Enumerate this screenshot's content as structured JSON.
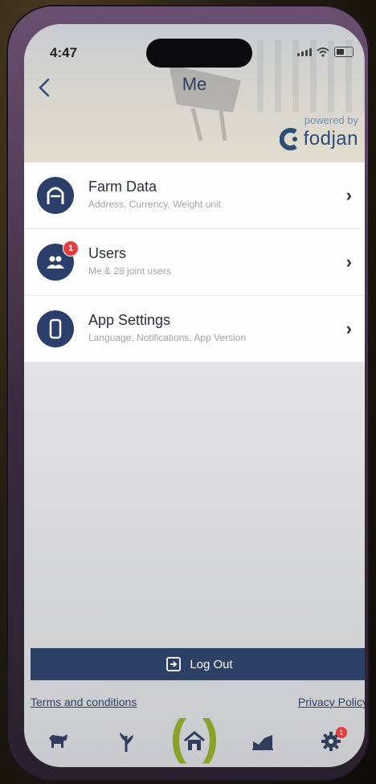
{
  "status_bar": {
    "time": "4:47"
  },
  "header": {
    "title": "Me",
    "powered_by": "powered by",
    "brand": "fodjan"
  },
  "menu": [
    {
      "label": "Farm Data",
      "subtitle": "Address, Currency, Weight unit",
      "icon": "barn-icon"
    },
    {
      "label": "Users",
      "subtitle": "Me & 28 joint users",
      "icon": "users-icon",
      "badge": "1"
    },
    {
      "label": "App Settings",
      "subtitle": "Language, Notifications, App Version",
      "icon": "smartphone-icon"
    }
  ],
  "logout_label": "Log Out",
  "footer": {
    "terms": "Terms and conditions",
    "privacy": "Privacy Policy"
  },
  "tabbar": {
    "items": [
      "cow-icon",
      "plant-icon",
      "home-icon",
      "chart-icon",
      "gear-icon"
    ],
    "settings_badge": "1"
  },
  "colors": {
    "primary": "#2b3f6a",
    "accent": "#8ca128",
    "badge": "#e43d3d"
  }
}
